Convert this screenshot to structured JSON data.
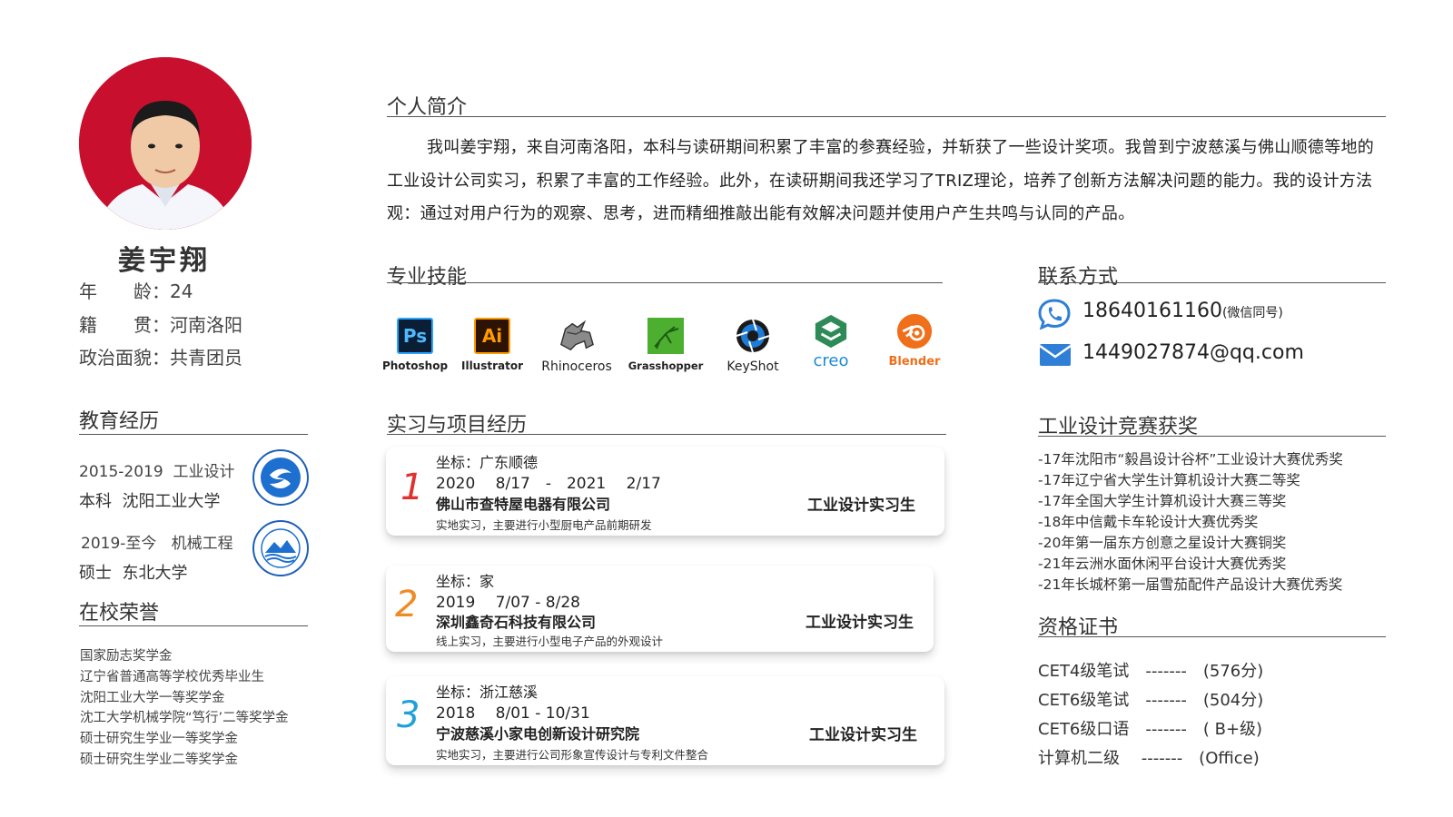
{
  "profile": {
    "name": "姜宇翔",
    "age_label": "年　　龄：",
    "age": "24",
    "hometown_label": "籍　　贯：",
    "hometown": "河南洛阳",
    "politics_label": "政治面貌：",
    "politics": "共青团员"
  },
  "education": {
    "title": "教育经历",
    "items": [
      {
        "period": "2015-2019",
        "major": "工业设计",
        "degree": "本科",
        "school": "沈阳工业大学",
        "logo": "sut-logo"
      },
      {
        "period": "2019-至今",
        "major": "机械工程",
        "degree": "硕士",
        "school": "东北大学",
        "logo": "neu-logo"
      }
    ]
  },
  "honors": {
    "title": "在校荣誉",
    "items": [
      "国家励志奖学金",
      "辽宁省普通高等学校优秀毕业生",
      "沈阳工业大学一等奖学金",
      "沈工大学机械学院“笃行’二等奖学金",
      "硕士研究生学业一等奖学金",
      "硕士研究生学业二等奖学金"
    ]
  },
  "intro": {
    "title": "个人简介",
    "text": "我叫姜宇翔，来自河南洛阳，本科与读研期间积累了丰富的参赛经验，并斩获了一些设计奖项。我曾到宁波慈溪与佛山顺德等地的工业设计公司实习，积累了丰富的工作经验。此外，在读研期间我还学习了TRIZ理论，培养了创新方法解决问题的能力。我的设计方法观：通过对用户行为的观察、思考，进而精细推敲出能有效解决问题并使用户产生共鸣与认同的产品。"
  },
  "skills": {
    "title": "专业技能",
    "items": [
      {
        "name": "Photoshop",
        "icon": "photoshop-icon",
        "glyph": "Ps"
      },
      {
        "name": "Illustrator",
        "icon": "illustrator-icon",
        "glyph": "Ai"
      },
      {
        "name": "Rhinoceros",
        "icon": "rhinoceros-icon",
        "glyph": ""
      },
      {
        "name": "Grasshopper",
        "icon": "grasshopper-icon",
        "glyph": ""
      },
      {
        "name": "KeyShot",
        "icon": "keyshot-icon",
        "glyph": ""
      },
      {
        "name": "creo",
        "icon": "creo-icon",
        "glyph": ""
      },
      {
        "name": "Blender",
        "icon": "blender-icon",
        "glyph": ""
      }
    ]
  },
  "experience": {
    "title": "实习与项目经历",
    "items": [
      {
        "num": "1",
        "location": "坐标：广东顺德",
        "dates": "2020　 8/17　-　2021　 2/17",
        "company": "佛山市查特屋电器有限公司",
        "desc": "实地实习，主要进行小型厨电产品前期研发",
        "role": "工业设计实习生",
        "color": "#e0312f"
      },
      {
        "num": "2",
        "location": "坐标：家",
        "dates": "2019　 7/07 - 8/28",
        "company": "深圳鑫奇石科技有限公司",
        "desc": "线上实习，主要进行小型电子产品的外观设计",
        "role": "工业设计实习生",
        "color": "#f08a24"
      },
      {
        "num": "3",
        "location": "坐标：浙江慈溪",
        "dates": "2018　 8/01 - 10/31",
        "company": "宁波慈溪小家电创新设计研究院",
        "desc": "实地实习，主要进行公司形象宣传设计与专利文件整合",
        "role": "工业设计实习生",
        "color": "#1fa0d8"
      }
    ]
  },
  "contact": {
    "title": "联系方式",
    "phone": "18640161160",
    "phone_note": "(微信同号)",
    "email": "1449027874@qq.com",
    "accent": "#2f7fd6"
  },
  "awards": {
    "title": "工业设计竞赛获奖",
    "items": [
      "-17年沈阳市“毅昌设计谷杯”工业设计大赛优秀奖",
      "-17年辽宁省大学生计算机设计大赛二等奖",
      "-17年全国大学生计算机设计大赛三等奖",
      "-18年中信戴卡车轮设计大赛优秀奖",
      "-20年第一届东方创意之星设计大赛铜奖",
      "-21年云洲水面休闲平台设计大赛优秀奖",
      "-21年长城杯第一届雪茄配件产品设计大赛优秀奖"
    ]
  },
  "certs": {
    "title": "资格证书",
    "items": [
      "CET4级笔试　-------　(576分)",
      "CET6级笔试　-------　(504分)",
      "CET6级口语　-------　( B+级)",
      "计算机二级　 -------　(Office)"
    ]
  }
}
